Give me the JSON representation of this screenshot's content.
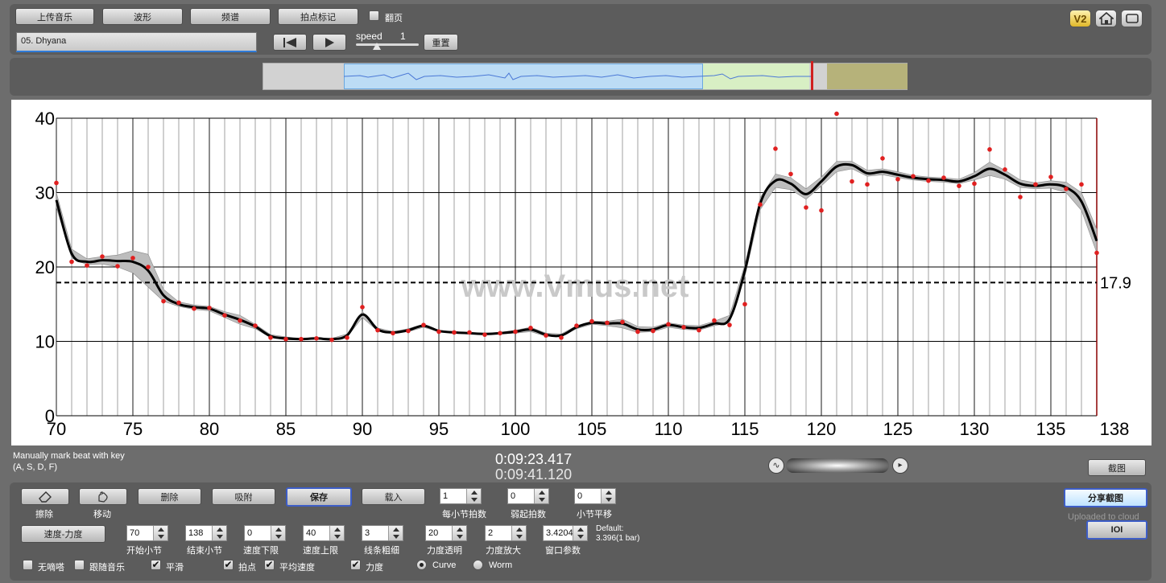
{
  "toolbar": {
    "upload_music": "上传音乐",
    "waveform": "波形",
    "spectrum": "频谱",
    "beat_marker": "拍点标记",
    "page_turn": "翻页",
    "page_turn_checked": false
  },
  "track": {
    "name": "05. Dhyana"
  },
  "playback": {
    "speed_label": "speed",
    "speed_value": "1",
    "reset_label": "重置"
  },
  "top_icons": [
    "v2-icon",
    "home-icon",
    "fullscreen-icon"
  ],
  "top_icon_labels": {
    "v2": "V2"
  },
  "chart_data": {
    "type": "line",
    "watermark": "www.Vmus.net",
    "xlim": [
      70,
      138
    ],
    "ylim": [
      0,
      40
    ],
    "x_ticks": [
      70,
      75,
      80,
      85,
      90,
      95,
      100,
      105,
      110,
      115,
      120,
      125,
      130,
      135,
      138
    ],
    "y_ticks": [
      0,
      10,
      20,
      30,
      40
    ],
    "grid": true,
    "mean_line": {
      "value": 17.9,
      "label": "17.9",
      "style": "dashed"
    },
    "curve_color": "#000000",
    "point_color": "#e02020",
    "band_color": "#bdbdbd",
    "points": [
      [
        70,
        31.3
      ],
      [
        71,
        20.7
      ],
      [
        72,
        20.2
      ],
      [
        73,
        21.4
      ],
      [
        74,
        20.1
      ],
      [
        75,
        21.2
      ],
      [
        76,
        20.0
      ],
      [
        77,
        15.4
      ],
      [
        78,
        15.2
      ],
      [
        79,
        14.4
      ],
      [
        80,
        14.5
      ],
      [
        81,
        13.5
      ],
      [
        82,
        12.8
      ],
      [
        83,
        12.1
      ],
      [
        84,
        10.5
      ],
      [
        85,
        10.3
      ],
      [
        86,
        10.3
      ],
      [
        87,
        10.4
      ],
      [
        88,
        10.2
      ],
      [
        89,
        10.5
      ],
      [
        90,
        14.6
      ],
      [
        91,
        11.5
      ],
      [
        92,
        11.1
      ],
      [
        93,
        11.4
      ],
      [
        94,
        12.2
      ],
      [
        95,
        11.3
      ],
      [
        96,
        11.2
      ],
      [
        97,
        11.2
      ],
      [
        98,
        10.9
      ],
      [
        99,
        11.1
      ],
      [
        100,
        11.3
      ],
      [
        101,
        11.8
      ],
      [
        102,
        10.8
      ],
      [
        103,
        10.5
      ],
      [
        104,
        12.1
      ],
      [
        105,
        12.7
      ],
      [
        106,
        12.5
      ],
      [
        107,
        12.6
      ],
      [
        108,
        11.3
      ],
      [
        109,
        11.4
      ],
      [
        110,
        12.3
      ],
      [
        111,
        11.9
      ],
      [
        112,
        11.5
      ],
      [
        113,
        12.8
      ],
      [
        114,
        12.2
      ],
      [
        115,
        15.0
      ],
      [
        116,
        28.4
      ],
      [
        117,
        35.9
      ],
      [
        118,
        32.5
      ],
      [
        119,
        28.0
      ],
      [
        120,
        27.6
      ],
      [
        121,
        40.6
      ],
      [
        122,
        31.5
      ],
      [
        123,
        31.1
      ],
      [
        124,
        34.6
      ],
      [
        125,
        31.8
      ],
      [
        126,
        32.2
      ],
      [
        127,
        31.6
      ],
      [
        128,
        32.0
      ],
      [
        129,
        30.9
      ],
      [
        130,
        31.2
      ],
      [
        131,
        35.8
      ],
      [
        132,
        33.1
      ],
      [
        133,
        29.4
      ],
      [
        134,
        31.1
      ],
      [
        135,
        32.1
      ],
      [
        136,
        30.5
      ],
      [
        137,
        31.1
      ],
      [
        138,
        21.9
      ]
    ],
    "curve": [
      [
        70,
        29.0
      ],
      [
        71,
        21.8
      ],
      [
        72,
        20.7
      ],
      [
        73,
        20.9
      ],
      [
        74,
        20.8
      ],
      [
        75,
        20.7
      ],
      [
        76,
        19.5
      ],
      [
        77,
        16.2
      ],
      [
        78,
        15.0
      ],
      [
        79,
        14.6
      ],
      [
        80,
        14.4
      ],
      [
        81,
        13.6
      ],
      [
        82,
        12.9
      ],
      [
        83,
        12.0
      ],
      [
        84,
        10.7
      ],
      [
        85,
        10.4
      ],
      [
        86,
        10.3
      ],
      [
        87,
        10.4
      ],
      [
        88,
        10.3
      ],
      [
        89,
        10.8
      ],
      [
        90,
        13.6
      ],
      [
        91,
        11.6
      ],
      [
        92,
        11.2
      ],
      [
        93,
        11.5
      ],
      [
        94,
        12.1
      ],
      [
        95,
        11.4
      ],
      [
        96,
        11.2
      ],
      [
        97,
        11.1
      ],
      [
        98,
        11.0
      ],
      [
        99,
        11.1
      ],
      [
        100,
        11.3
      ],
      [
        101,
        11.6
      ],
      [
        102,
        10.9
      ],
      [
        103,
        10.8
      ],
      [
        104,
        11.9
      ],
      [
        105,
        12.5
      ],
      [
        106,
        12.4
      ],
      [
        107,
        12.4
      ],
      [
        108,
        11.6
      ],
      [
        109,
        11.6
      ],
      [
        110,
        12.2
      ],
      [
        111,
        11.9
      ],
      [
        112,
        11.8
      ],
      [
        113,
        12.4
      ],
      [
        114,
        13.0
      ],
      [
        115,
        19.5
      ],
      [
        116,
        28.5
      ],
      [
        117,
        31.6
      ],
      [
        118,
        31.2
      ],
      [
        119,
        29.8
      ],
      [
        120,
        31.5
      ],
      [
        121,
        33.5
      ],
      [
        122,
        33.7
      ],
      [
        123,
        32.6
      ],
      [
        124,
        32.8
      ],
      [
        125,
        32.4
      ],
      [
        126,
        32.0
      ],
      [
        127,
        31.8
      ],
      [
        128,
        31.7
      ],
      [
        129,
        31.5
      ],
      [
        130,
        32.2
      ],
      [
        131,
        33.2
      ],
      [
        132,
        32.4
      ],
      [
        133,
        31.2
      ],
      [
        134,
        30.9
      ],
      [
        135,
        31.1
      ],
      [
        136,
        30.7
      ],
      [
        137,
        28.8
      ],
      [
        138,
        23.5
      ]
    ],
    "band": [
      [
        70,
        1.0
      ],
      [
        71,
        0.6
      ],
      [
        72,
        0.4
      ],
      [
        73,
        0.5
      ],
      [
        74,
        0.8
      ],
      [
        75,
        1.5
      ],
      [
        76,
        2.2
      ],
      [
        77,
        0.8
      ],
      [
        78,
        0.3
      ],
      [
        79,
        0.3
      ],
      [
        80,
        0.3
      ],
      [
        81,
        0.4
      ],
      [
        82,
        0.6
      ],
      [
        83,
        0.3
      ],
      [
        84,
        0.2
      ],
      [
        85,
        0.2
      ],
      [
        86,
        0.1
      ],
      [
        87,
        0.1
      ],
      [
        88,
        0.1
      ],
      [
        89,
        0.2
      ],
      [
        90,
        0.4
      ],
      [
        91,
        0.2
      ],
      [
        92,
        0.1
      ],
      [
        93,
        0.2
      ],
      [
        94,
        0.2
      ],
      [
        95,
        0.1
      ],
      [
        96,
        0.1
      ],
      [
        97,
        0.1
      ],
      [
        98,
        0.1
      ],
      [
        99,
        0.1
      ],
      [
        100,
        0.2
      ],
      [
        101,
        0.3
      ],
      [
        102,
        0.2
      ],
      [
        103,
        0.2
      ],
      [
        104,
        0.2
      ],
      [
        105,
        0.2
      ],
      [
        106,
        0.3
      ],
      [
        107,
        0.6
      ],
      [
        108,
        0.4
      ],
      [
        109,
        0.3
      ],
      [
        110,
        0.3
      ],
      [
        111,
        0.3
      ],
      [
        112,
        0.3
      ],
      [
        113,
        0.3
      ],
      [
        114,
        0.5
      ],
      [
        115,
        0.8
      ],
      [
        116,
        0.8
      ],
      [
        117,
        0.9
      ],
      [
        118,
        0.8
      ],
      [
        119,
        0.7
      ],
      [
        120,
        0.6
      ],
      [
        121,
        0.7
      ],
      [
        122,
        0.5
      ],
      [
        123,
        0.4
      ],
      [
        124,
        0.4
      ],
      [
        125,
        0.4
      ],
      [
        126,
        0.3
      ],
      [
        127,
        0.3
      ],
      [
        128,
        0.3
      ],
      [
        129,
        0.3
      ],
      [
        130,
        0.5
      ],
      [
        131,
        0.9
      ],
      [
        132,
        0.6
      ],
      [
        133,
        0.5
      ],
      [
        134,
        0.4
      ],
      [
        135,
        0.5
      ],
      [
        136,
        0.7
      ],
      [
        137,
        1.2
      ],
      [
        138,
        1.6
      ]
    ]
  },
  "status": {
    "hint_line1": "Manually mark beat with key",
    "hint_line2": "(A, S, D, F)",
    "time_current": "0:09:23.417",
    "time_total": "0:09:41.120",
    "screenshot": "截图"
  },
  "tools": {
    "erase": "擦除",
    "move": "移动",
    "delete": "删除",
    "snap": "吸附",
    "save": "保存",
    "load": "载入",
    "tempo_dynamics": "速度-力度"
  },
  "spinners_row1": [
    {
      "value": "1",
      "label": "每小节拍数"
    },
    {
      "value": "0",
      "label": "弱起拍数"
    },
    {
      "value": "0",
      "label": "小节平移"
    }
  ],
  "spinners_row2": [
    {
      "value": "70",
      "label": "开始小节"
    },
    {
      "value": "138",
      "label": "结束小节"
    },
    {
      "value": "0",
      "label": "速度下限"
    },
    {
      "value": "40",
      "label": "速度上限"
    },
    {
      "value": "3",
      "label": "线条粗细"
    },
    {
      "value": "20",
      "label": "力度透明"
    },
    {
      "value": "2",
      "label": "力度放大"
    },
    {
      "value": "3.4204",
      "label": "窗口参数"
    }
  ],
  "default_note": {
    "line1": "Default:",
    "line2": "3.396(1 bar)"
  },
  "checkboxes": [
    {
      "label": "无嘀嗒",
      "checked": false
    },
    {
      "label": "跟随音乐",
      "checked": false
    },
    {
      "label": "平滑",
      "checked": true
    },
    {
      "label": "拍点",
      "checked": true
    },
    {
      "label": "平均速度",
      "checked": true
    },
    {
      "label": "力度",
      "checked": true
    }
  ],
  "radios": [
    {
      "label": "Curve",
      "selected": true
    },
    {
      "label": "Worm",
      "selected": false
    }
  ],
  "share": {
    "share_screenshot": "分享截图",
    "uploaded_note": "Uploaded to cloud",
    "ioi": "IOI"
  }
}
